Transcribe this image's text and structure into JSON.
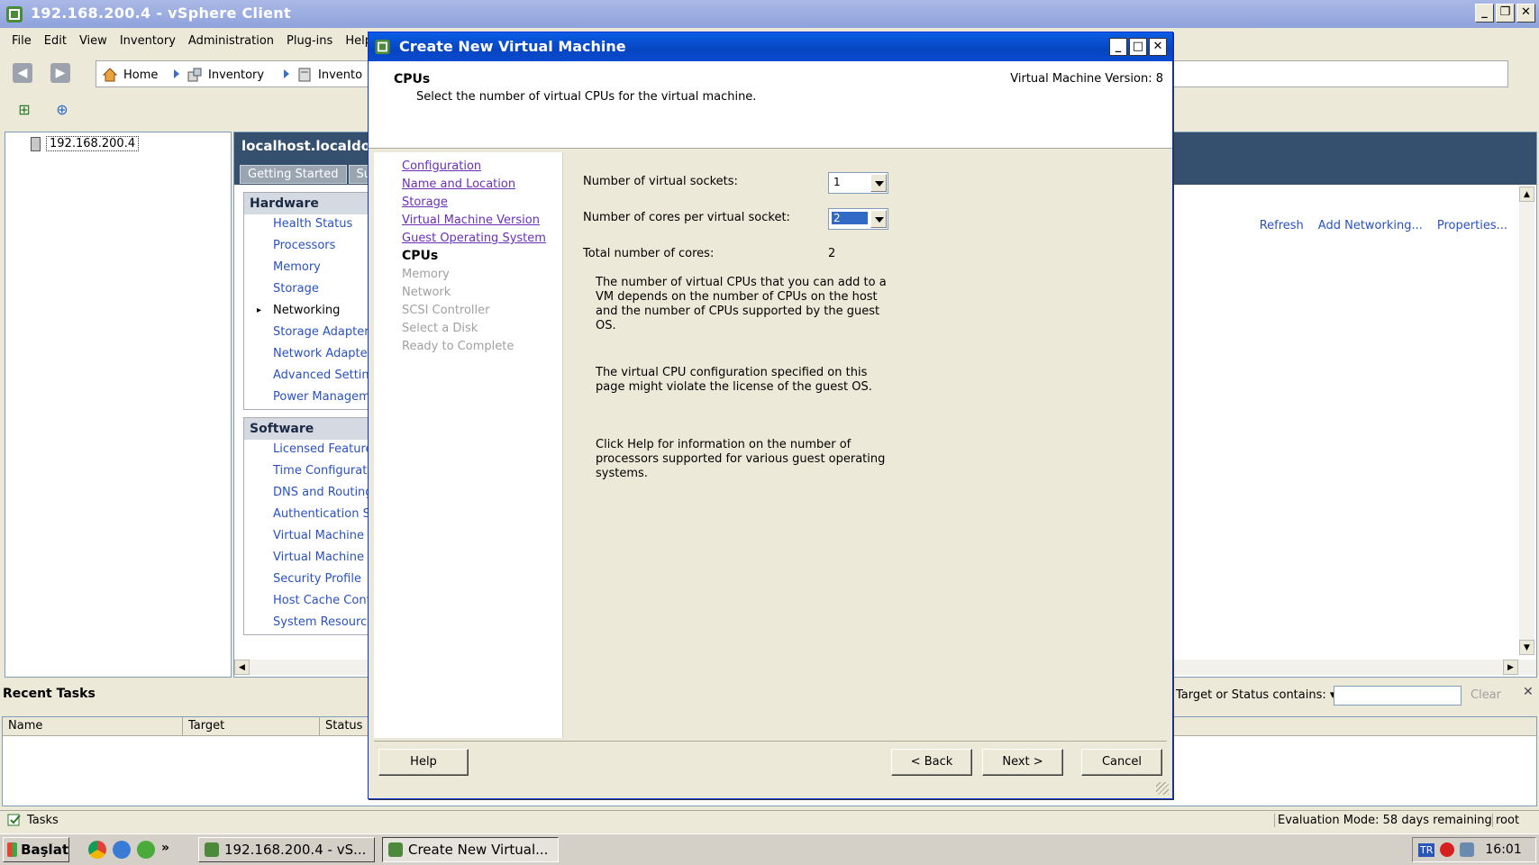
{
  "window": {
    "title": "192.168.200.4 - vSphere Client",
    "controls": [
      "_",
      "❐",
      "✕"
    ]
  },
  "menubar": [
    "File",
    "Edit",
    "View",
    "Inventory",
    "Administration",
    "Plug-ins",
    "Help"
  ],
  "breadcrumb": [
    "Home",
    "Inventory",
    "Invento"
  ],
  "tree": {
    "host": "192.168.200.4"
  },
  "host_pane": {
    "title": "localhost.localdoma",
    "tabs": [
      "Getting Started",
      "Su"
    ],
    "hardware": {
      "heading": "Hardware",
      "items": [
        "Health Status",
        "Processors",
        "Memory",
        "Storage",
        "Networking",
        "Storage Adapters",
        "Network Adapters",
        "Advanced Settings",
        "Power Management"
      ]
    },
    "software": {
      "heading": "Software",
      "items": [
        "Licensed Features",
        "Time Configuration",
        "DNS and Routing",
        "Authentication Se",
        "Virtual Machine S",
        "Virtual Machine S",
        "Security Profile",
        "Host Cache Conf",
        "System Resource"
      ]
    },
    "actions": [
      "Refresh",
      "Add Networking...",
      "Properties..."
    ]
  },
  "recent_tasks": {
    "title": "Recent Tasks",
    "filter_label": "Target or Status contains: ▾",
    "filter_value": "",
    "clear": "Clear",
    "columns": [
      "Name",
      "Target",
      "Status"
    ]
  },
  "statusbar": {
    "tasks": "Tasks",
    "evaluation": "Evaluation Mode: 58 days remaining",
    "user": "root"
  },
  "taskbar": {
    "start": "Başlat",
    "more": "»",
    "buttons": [
      "192.168.200.4 - vS...",
      "Create New Virtual..."
    ],
    "lang": "TR",
    "clock": "16:01"
  },
  "dialog": {
    "title": "Create New Virtual Machine",
    "page_title": "CPUs",
    "subtitle": "Select the number of virtual CPUs for the virtual machine.",
    "version": "Virtual Machine Version: 8",
    "steps_done": [
      "Configuration",
      "Name and Location",
      "Storage",
      "Virtual Machine Version",
      "Guest Operating System"
    ],
    "step_current": "CPUs",
    "steps_future": [
      "Memory",
      "Network",
      "SCSI Controller",
      "Select a Disk",
      "Ready to Complete"
    ],
    "sockets_label": "Number of virtual sockets:",
    "sockets_value": "1",
    "cores_label": "Number of cores per virtual socket:",
    "cores_value": "2",
    "total_label": "Total number of cores:",
    "total_value": "2",
    "para1": "The number of virtual CPUs that you can add to a VM depends on the number of CPUs on the host and the number of CPUs supported by the guest OS.",
    "para2": "The virtual CPU configuration specified on this page might violate the license of the guest OS.",
    "para3": "Click Help for information on the number of processors supported for various guest operating systems.",
    "buttons": {
      "help": "Help",
      "back": "< Back",
      "next": "Next >",
      "cancel": "Cancel"
    }
  }
}
